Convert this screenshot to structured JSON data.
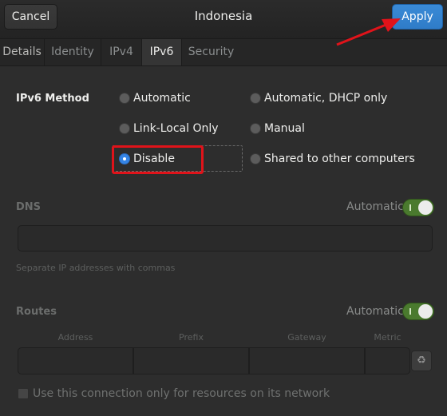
{
  "header": {
    "title": "Indonesia",
    "cancel_label": "Cancel",
    "apply_label": "Apply"
  },
  "tabs": [
    {
      "label": "Details"
    },
    {
      "label": "Identity"
    },
    {
      "label": "IPv4"
    },
    {
      "label": "IPv6",
      "active": true
    },
    {
      "label": "Security"
    }
  ],
  "ipv6_method": {
    "label": "IPv6 Method",
    "options": [
      {
        "label": "Automatic",
        "checked": false
      },
      {
        "label": "Automatic, DHCP only",
        "checked": false
      },
      {
        "label": "Link-Local Only",
        "checked": false
      },
      {
        "label": "Manual",
        "checked": false
      },
      {
        "label": "Disable",
        "checked": true
      },
      {
        "label": "Shared to other computers",
        "checked": false
      }
    ]
  },
  "dns": {
    "label": "DNS",
    "automatic_label": "Automatic",
    "automatic_on": true,
    "value": "",
    "hint": "Separate IP addresses with commas"
  },
  "routes": {
    "label": "Routes",
    "automatic_label": "Automatic",
    "automatic_on": true,
    "columns": [
      "Address",
      "Prefix",
      "Gateway",
      "Metric"
    ]
  },
  "only_local_resources": {
    "label": "Use this connection only for resources on its network",
    "checked": false
  },
  "colors": {
    "accent": "#3584e4",
    "switch_on": "#4a7a2e",
    "annotation": "#e0131a"
  }
}
